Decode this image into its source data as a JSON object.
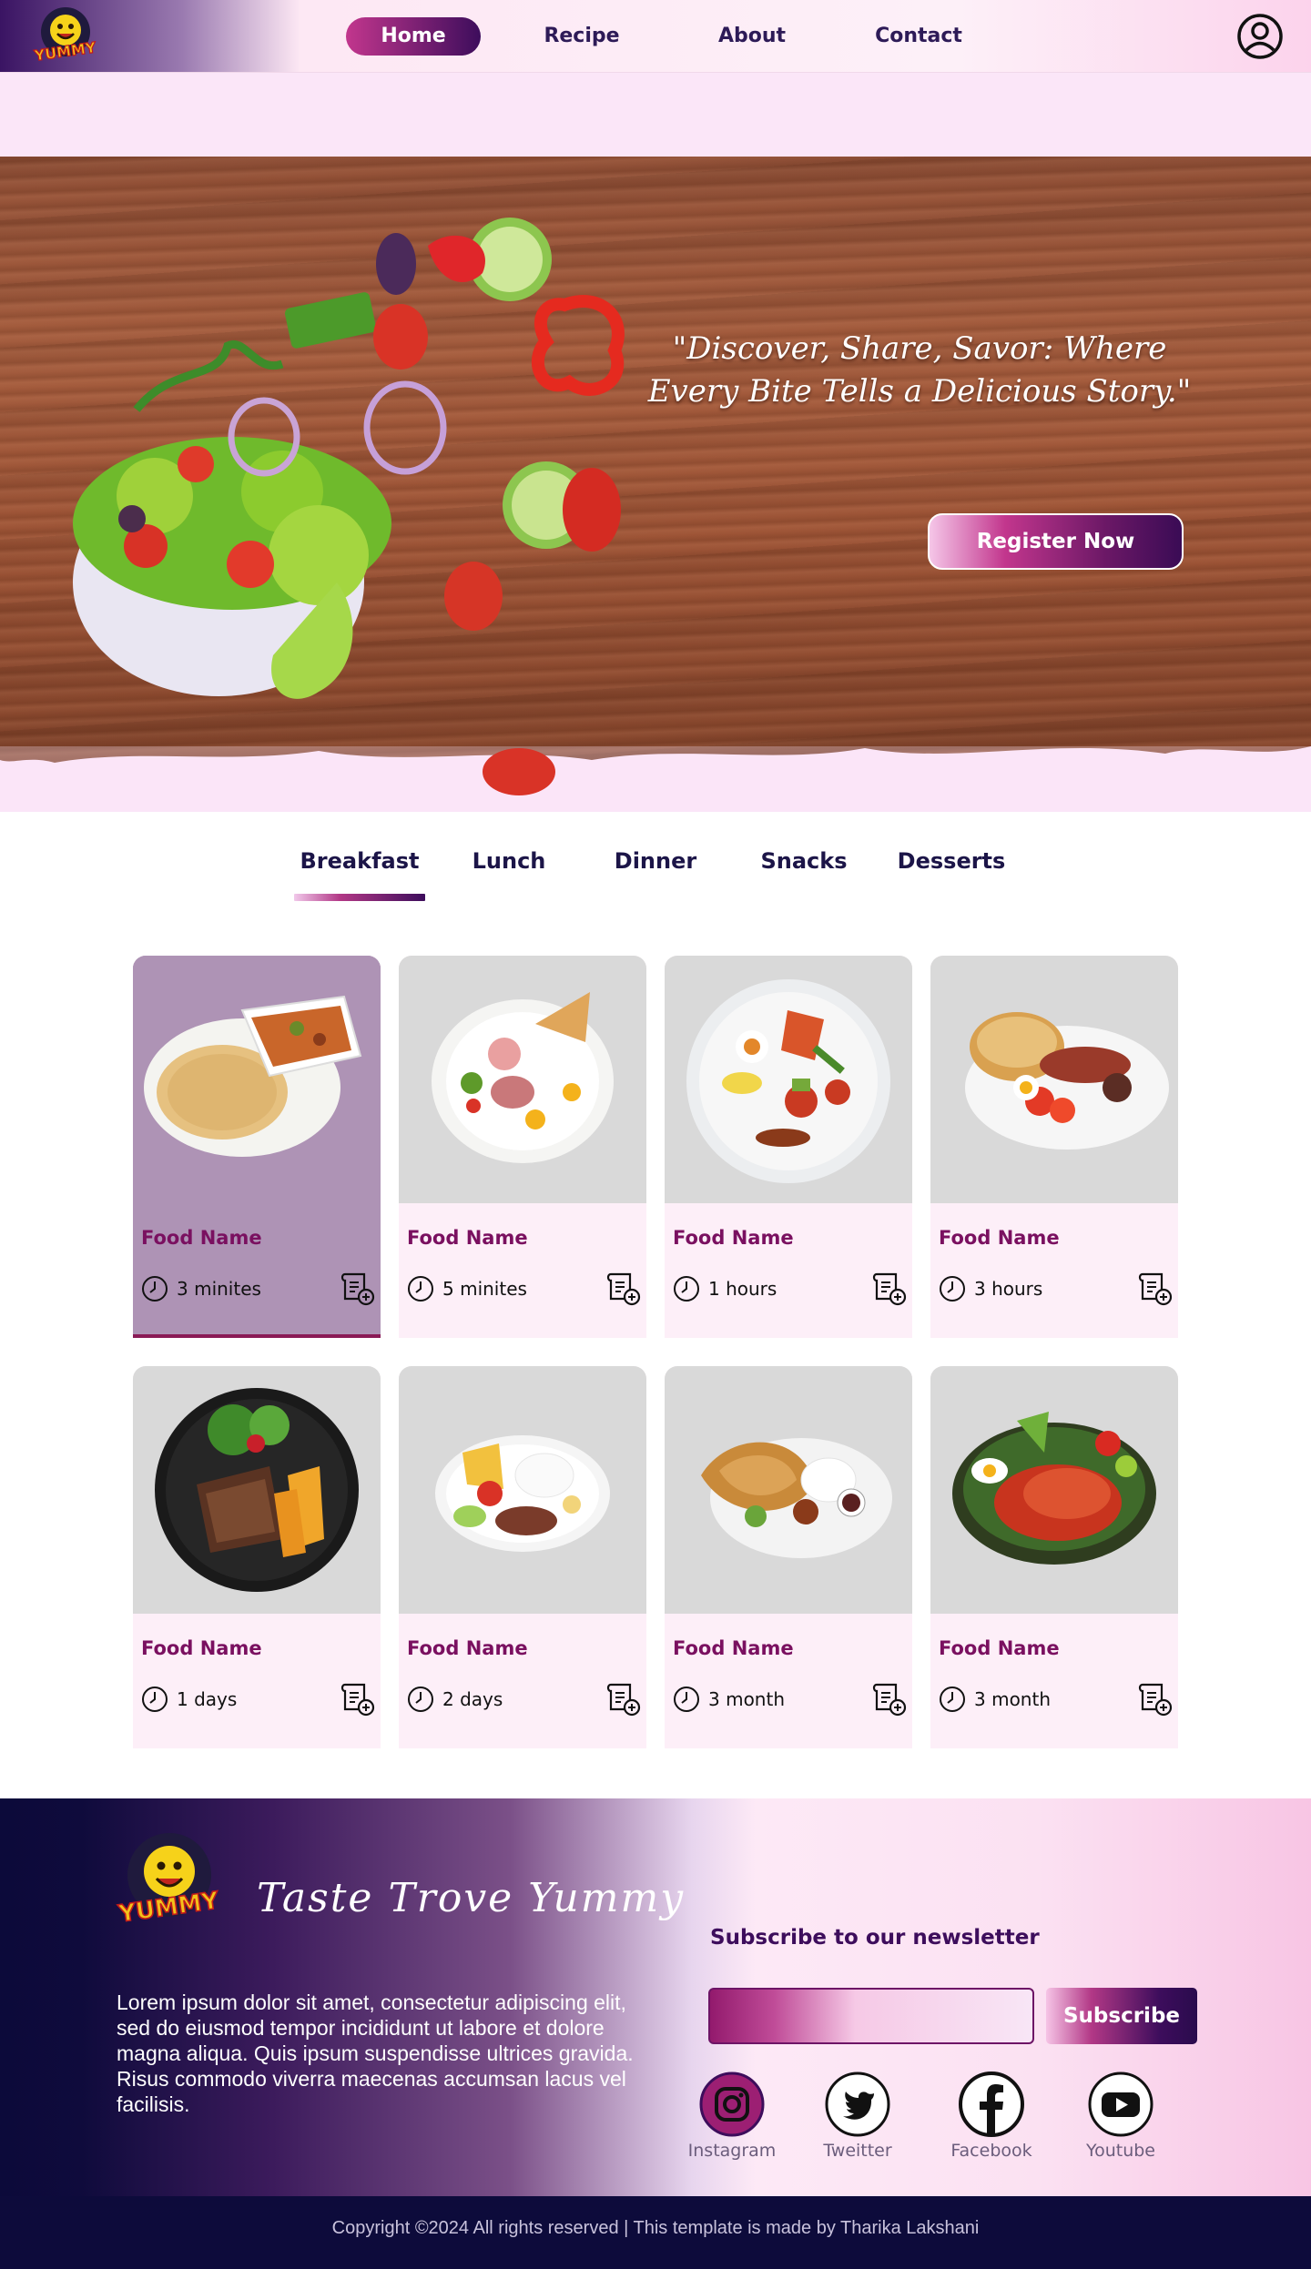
{
  "brand": {
    "logo_text": "YUMMY"
  },
  "nav": {
    "items": [
      {
        "label": "Home",
        "active": true
      },
      {
        "label": "Recipe",
        "active": false
      },
      {
        "label": "About",
        "active": false
      },
      {
        "label": "Contact",
        "active": false
      }
    ],
    "profile_icon": "user-circle-icon"
  },
  "hero": {
    "quote": "\"Discover, Share, Savor: Where Every Bite Tells a Delicious Story.\"",
    "cta_label": "Register Now"
  },
  "categories": {
    "tabs": [
      {
        "label": "Breakfast",
        "active": true
      },
      {
        "label": "Lunch",
        "active": false
      },
      {
        "label": "Dinner",
        "active": false
      },
      {
        "label": "Snacks",
        "active": false
      },
      {
        "label": "Desserts",
        "active": false
      }
    ]
  },
  "cards": [
    {
      "name": "Food Name",
      "time": "3 minites",
      "active": true
    },
    {
      "name": "Food Name",
      "time": "5 minites",
      "active": false
    },
    {
      "name": "Food Name",
      "time": "1 hours",
      "active": false
    },
    {
      "name": "Food Name",
      "time": "3 hours",
      "active": false
    },
    {
      "name": "Food Name",
      "time": "1 days",
      "active": false
    },
    {
      "name": "Food Name",
      "time": "2 days",
      "active": false
    },
    {
      "name": "Food Name",
      "time": "3 month",
      "active": false
    },
    {
      "name": "Food Name",
      "time": "3 month",
      "active": false
    }
  ],
  "footer": {
    "tagline": "Taste Trove Yummy",
    "about_text": "Lorem ipsum dolor sit amet, consectetur adipiscing elit, sed do eiusmod tempor incididunt ut labore et dolore magna aliqua. Quis ipsum suspendisse ultrices gravida. Risus commodo viverra maecenas accumsan lacus vel facilisis.",
    "newsletter_title": "Subscribe to our newsletter",
    "email_value": "",
    "subscribe_label": "Subscribe",
    "socials": [
      {
        "label": "Instagram",
        "icon": "instagram-icon"
      },
      {
        "label": "Tweitter",
        "icon": "twitter-icon"
      },
      {
        "label": "Facebook",
        "icon": "facebook-icon"
      },
      {
        "label": "Youtube",
        "icon": "youtube-icon"
      }
    ],
    "copyright": "Copyright ©2024 All rights reserved | This template is made by Tharika Lakshani"
  },
  "colors": {
    "accent_pink": "#c2368d",
    "accent_purple": "#3d0d5c",
    "food_name": "#7a1060",
    "card_bg": "#fdeff8",
    "card_img_bg": "#d9d9d9",
    "active_card_bg": "#ae93b5",
    "footer_dark": "#0d0b3b"
  }
}
